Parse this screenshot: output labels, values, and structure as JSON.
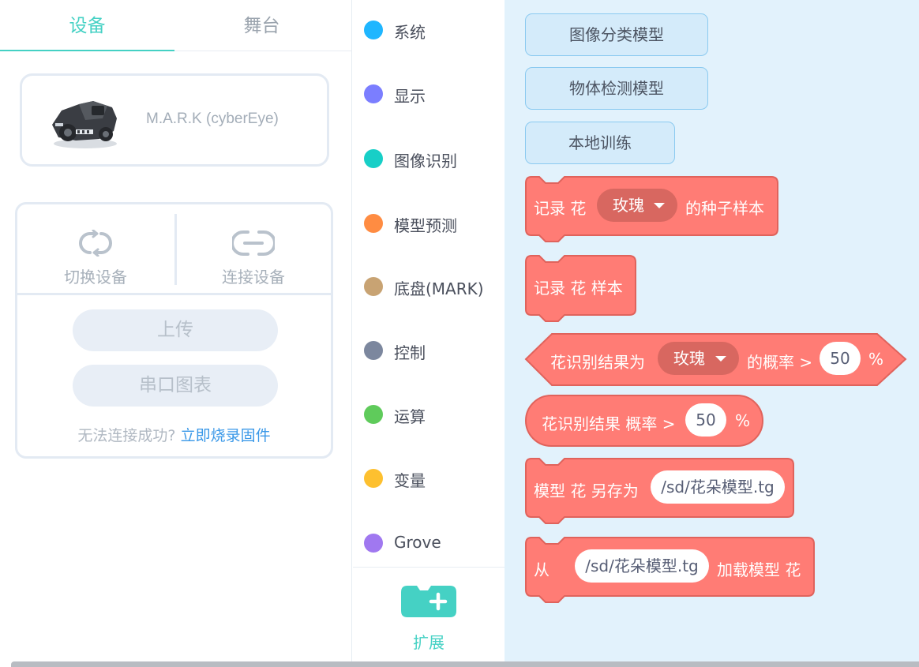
{
  "tabs": {
    "device": "设备",
    "stage": "舞台"
  },
  "device": {
    "name": "M.A.R.K (cyberEye)"
  },
  "connection": {
    "switch_label": "切换设备",
    "connect_label": "连接设备",
    "upload_label": "上传",
    "serial_chart_label": "串口图表",
    "help_question": "无法连接成功?",
    "help_link": "立即烧录固件"
  },
  "categories": [
    {
      "label": "系统",
      "color": "#1fb6ff"
    },
    {
      "label": "显示",
      "color": "#7b7eff"
    },
    {
      "label": "图像识别",
      "color": "#17cfc7"
    },
    {
      "label": "模型预测",
      "color": "#ff8c42"
    },
    {
      "label": "底盘(MARK)",
      "color": "#c8a373"
    },
    {
      "label": "控制",
      "color": "#7c879e"
    },
    {
      "label": "运算",
      "color": "#5fcb5b"
    },
    {
      "label": "变量",
      "color": "#fdc02f"
    },
    {
      "label": "Grove",
      "color": "#a078f0"
    }
  ],
  "extension": {
    "label": "扩展",
    "color": "#45d1c4"
  },
  "buttons": {
    "image_classification": "图像分类模型",
    "object_detection": "物体检测模型",
    "local_training": "本地训练"
  },
  "blocks": {
    "record_sample": {
      "prefix": "记录 花",
      "option": "玫瑰",
      "suffix": "的种子样本"
    },
    "record_flower_sample": {
      "text": "记录 花 样本"
    },
    "result_is": {
      "prefix": "花识别结果为",
      "option": "玫瑰",
      "middle": "的概率 >",
      "value": "50",
      "unit": "%"
    },
    "result_prob": {
      "prefix": "花识别结果 概率 >",
      "value": "50",
      "unit": "%"
    },
    "save_model": {
      "prefix": "模型 花 另存为",
      "path": "/sd/花朵模型.tg"
    },
    "load_model": {
      "prefix": "从",
      "path": "/sd/花朵模型.tg",
      "suffix": "加载模型 花"
    }
  },
  "colors": {
    "accent": "#45d1c4",
    "block": "#ff7c75",
    "block_dark": "#d86760",
    "block_border": "#e0635c",
    "script_bg": "#e2f2fc",
    "link": "#3a98e8"
  }
}
